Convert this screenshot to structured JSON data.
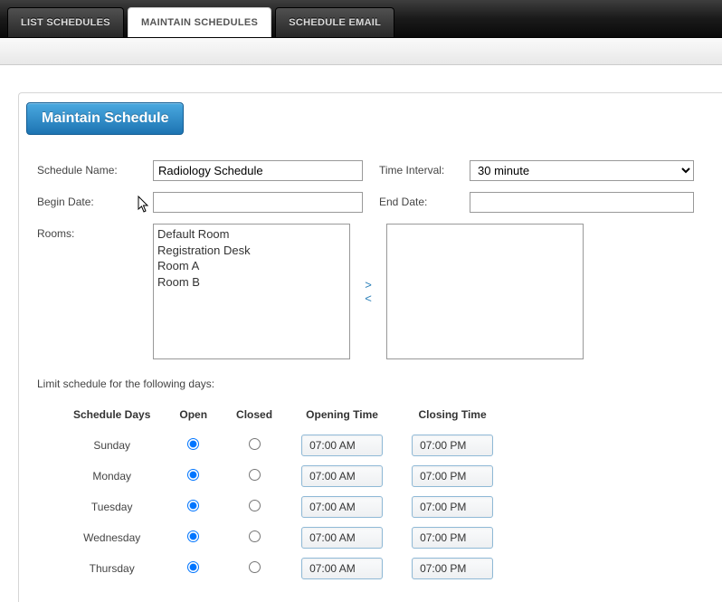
{
  "tabs": {
    "list": "LIST SCHEDULES",
    "maintain": "MAINTAIN SCHEDULES",
    "email": "SCHEDULE EMAIL"
  },
  "panel": {
    "title": "Maintain Schedule"
  },
  "labels": {
    "schedule_name": "Schedule Name:",
    "time_interval": "Time Interval:",
    "begin_date": "Begin Date:",
    "end_date": "End Date:",
    "rooms": "Rooms:",
    "limit": "Limit schedule for the following days:",
    "col_days": "Schedule Days",
    "col_open": "Open",
    "col_closed": "Closed",
    "col_opening": "Opening Time",
    "col_closing": "Closing Time"
  },
  "values": {
    "schedule_name": "Radiology Schedule",
    "time_interval": "30 minute",
    "begin_date": "",
    "end_date": ""
  },
  "rooms_available": [
    "Default Room",
    "Registration Desk",
    "Room A",
    "Room B"
  ],
  "transfer": {
    "right": ">",
    "left": "<"
  },
  "days": [
    {
      "name": "Sunday",
      "open": true,
      "opening": "07:00 AM",
      "closing": "07:00 PM"
    },
    {
      "name": "Monday",
      "open": true,
      "opening": "07:00 AM",
      "closing": "07:00 PM"
    },
    {
      "name": "Tuesday",
      "open": true,
      "opening": "07:00 AM",
      "closing": "07:00 PM"
    },
    {
      "name": "Wednesday",
      "open": true,
      "opening": "07:00 AM",
      "closing": "07:00 PM"
    },
    {
      "name": "Thursday",
      "open": true,
      "opening": "07:00 AM",
      "closing": "07:00 PM"
    }
  ]
}
